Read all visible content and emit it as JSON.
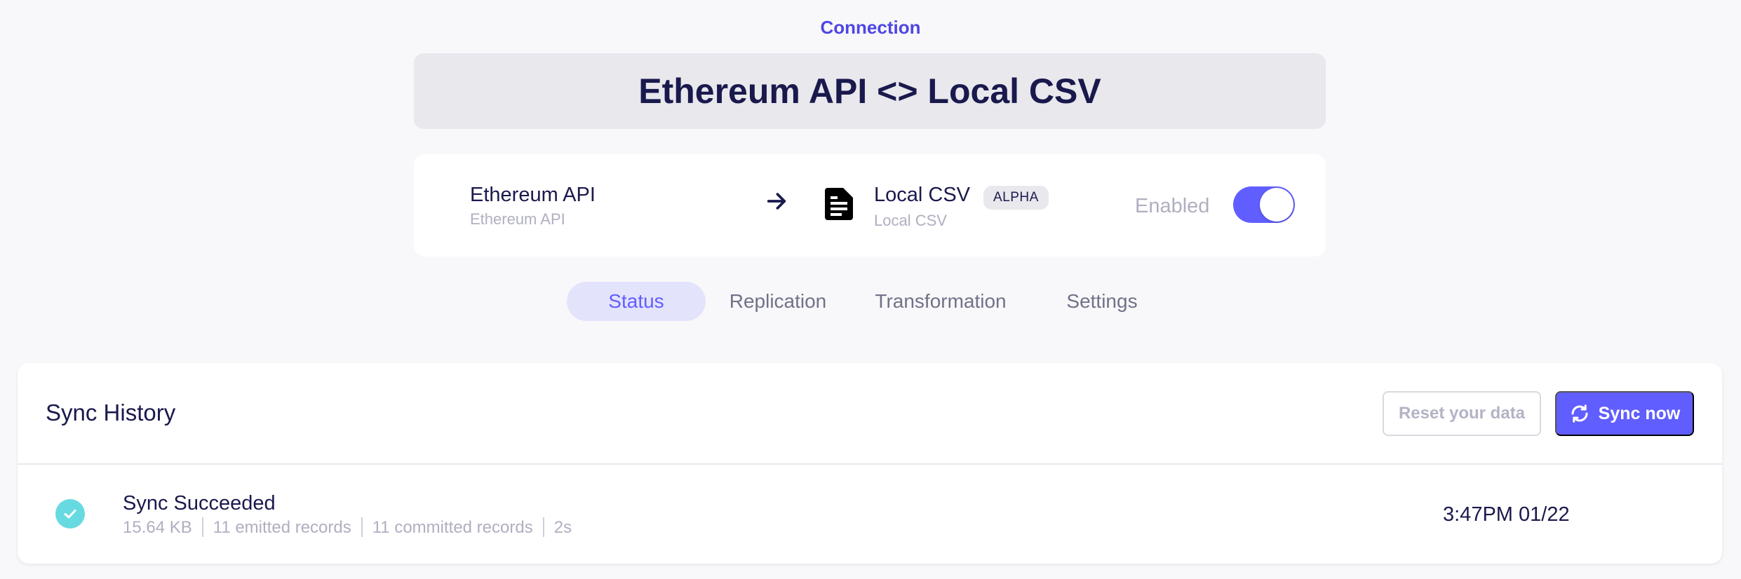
{
  "header": {
    "section_label": "Connection",
    "title": "Ethereum API <> Local CSV"
  },
  "connection": {
    "source_name": "Ethereum API",
    "source_type": "Ethereum API",
    "destination_name": "Local CSV",
    "destination_type": "Local CSV",
    "destination_badge": "ALPHA",
    "enabled_label": "Enabled",
    "enabled": true,
    "arrow_icon": "arrow-right-icon",
    "destination_icon": "document-icon"
  },
  "tabs": [
    {
      "label": "Status",
      "active": true
    },
    {
      "label": "Replication",
      "active": false
    },
    {
      "label": "Transformation",
      "active": false
    },
    {
      "label": "Settings",
      "active": false
    }
  ],
  "sync_history": {
    "title": "Sync History",
    "reset_label": "Reset your data",
    "sync_label": "Sync now",
    "sync_icon": "refresh-icon",
    "jobs": [
      {
        "status": "Sync Succeeded",
        "status_icon": "check-circle-icon",
        "size": "15.64 KB",
        "emitted": "11 emitted records",
        "committed": "11 committed records",
        "duration": "2s",
        "time": "3:47PM 01/22"
      }
    ]
  },
  "colors": {
    "accent": "#615eff",
    "title_text": "#1a194d",
    "muted_text": "#afafc1",
    "success": "#67dae1",
    "background": "#f8f8fa"
  }
}
